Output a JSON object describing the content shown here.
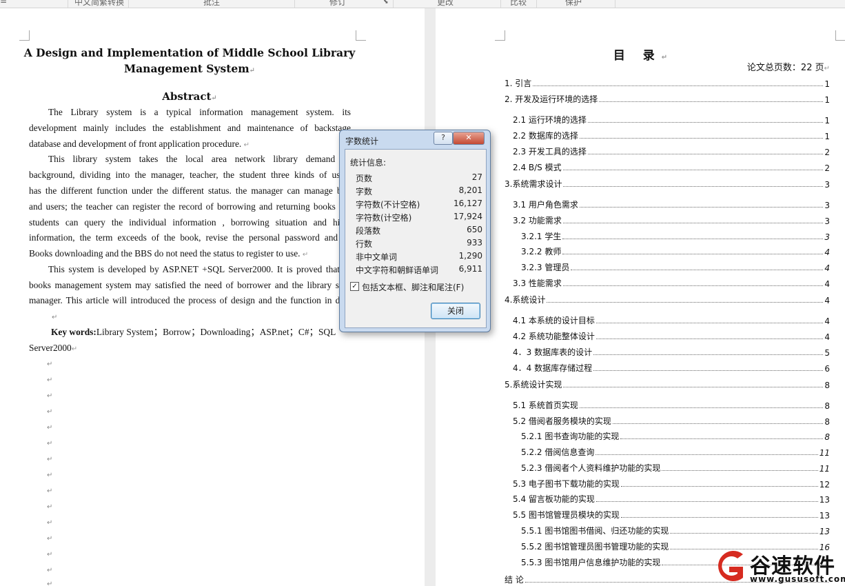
{
  "ribbon": {
    "items": [
      "中文简繁转换",
      "批注",
      "修订",
      "更改",
      "比较",
      "保护"
    ]
  },
  "paper": {
    "title_line1": "A Design and Implementation of Middle School Library",
    "title_line2": "Management System",
    "abstract_heading": "Abstract",
    "lines": [
      "The Library system is a typical information management system. its",
      "development mainly includes the establishment and maintenance of backstage",
      "database and development of front application procedure.",
      "This library system takes the local area network library demand as",
      "background, dividing into the manager, teacher, the student three kinds of users",
      "has the different function under the different status. the manager can manage boo",
      "and users; the teacher can register the record of borrowing and returning books ; T",
      "students can query the individual information , borrowing situation and histo",
      "information, the term exceeds of the book, revise the personal password and so",
      "Books downloading and the BBS do not need the status to register to use.",
      "This system is developed by ASP.NET +SQL Server2000. It is proved that th",
      "books management system may satisfied the need of borrower and the library serv",
      "manager. This article will introduced the process of design and the function in deta"
    ],
    "keywords_label": "Key words:",
    "keywords_value": "Library System；Borrow；Downloading；ASP.net；C#；SQL",
    "keywords_line2": "Server2000"
  },
  "toc": {
    "title": "目 录",
    "total_pages": "论文总页数：22 页",
    "entries": [
      {
        "label": "1. 引言",
        "page": "1"
      },
      {
        "label": "2. 开发及运行环境的选择",
        "page": "1"
      },
      {
        "label": "2.1 运行环境的选择",
        "page": "1"
      },
      {
        "label": "2.2 数据库的选择",
        "page": "1"
      },
      {
        "label": "2.3 开发工具的选择",
        "page": "2"
      },
      {
        "label": "2.4 B/S 模式",
        "page": "2"
      },
      {
        "label": "3.系统需求设计",
        "page": "3"
      },
      {
        "label": "3.1 用户角色需求",
        "page": "3"
      },
      {
        "label": "3.2 功能需求",
        "page": "3"
      },
      {
        "label": "3.2.1 学生",
        "page": "3"
      },
      {
        "label": "3.2.2 教师",
        "page": "4"
      },
      {
        "label": "3.2.3 管理员",
        "page": "4"
      },
      {
        "label": "3.3 性能需求",
        "page": "4"
      },
      {
        "label": "4.系统设计",
        "page": "4"
      },
      {
        "label": "4.1 本系统的设计目标",
        "page": "4"
      },
      {
        "label": "4.2 系统功能整体设计",
        "page": "4"
      },
      {
        "label": "4．3 数据库表的设计",
        "page": "5"
      },
      {
        "label": "4．4 数据库存储过程",
        "page": "6"
      },
      {
        "label": "5.系统设计实现",
        "page": "8"
      },
      {
        "label": "5.1 系统首页实现",
        "page": "8"
      },
      {
        "label": "5.2 借阅者服务模块的实现",
        "page": "8"
      },
      {
        "label": "5.2.1 图书查询功能的实现",
        "page": "8"
      },
      {
        "label": "5.2.2 借阅信息查询",
        "page": "11"
      },
      {
        "label": "5.2.3 借阅者个人资料维护功能的实现",
        "page": "11"
      },
      {
        "label": "5.3 电子图书下载功能的实现",
        "page": "12"
      },
      {
        "label": "5.4 留言板功能的实现",
        "page": "13"
      },
      {
        "label": "5.5 图书馆管理员模块的实现",
        "page": "13"
      },
      {
        "label": "5.5.1 图书馆图书借阅、归还功能的实现",
        "page": "13"
      },
      {
        "label": "5.5.2 图书馆管理员图书管理功能的实现",
        "page": "16"
      },
      {
        "label": "5.5.3 图书馆用户信息维护功能的实现",
        "page": ""
      },
      {
        "label": "结    论",
        "page": ""
      }
    ]
  },
  "dialog": {
    "title": "字数统计",
    "help_label": "?",
    "close_x": "✕",
    "header": "统计信息:",
    "stats": [
      {
        "label": "页数",
        "value": "27"
      },
      {
        "label": "字数",
        "value": "8,201"
      },
      {
        "label": "字符数(不计空格)",
        "value": "16,127"
      },
      {
        "label": "字符数(计空格)",
        "value": "17,924"
      },
      {
        "label": "段落数",
        "value": "650"
      },
      {
        "label": "行数",
        "value": "933"
      },
      {
        "label": "非中文单词",
        "value": "1,290"
      },
      {
        "label": "中文字符和朝鲜语单词",
        "value": "6,911"
      }
    ],
    "checkbox_label": "包括文本框、脚注和尾注(F)",
    "checkbox_checked": true,
    "close_button": "关闭"
  },
  "watermark": {
    "brand": "谷速软件",
    "url": "www.gususoft.com"
  }
}
